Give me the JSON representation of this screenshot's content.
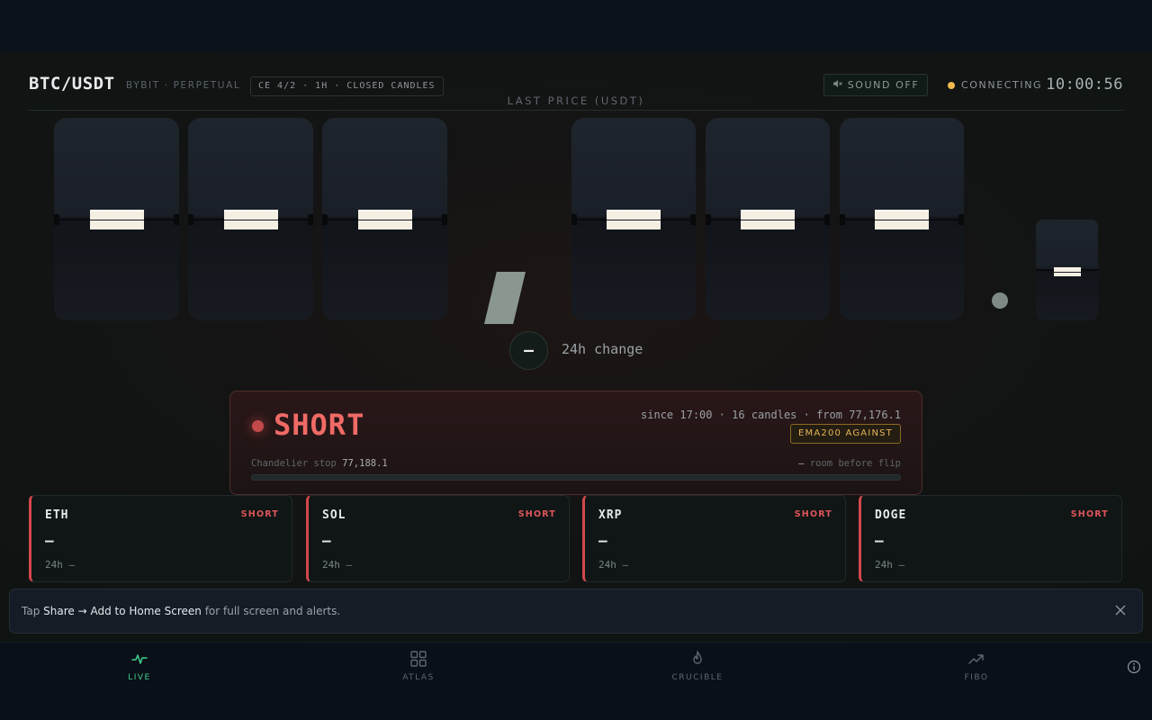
{
  "header": {
    "pair": "BTC/USDT",
    "exchange": "BYBIT · PERPETUAL",
    "mode_badge": "CE 4/2 · 1H · CLOSED CANDLES",
    "sound_label": "SOUND OFF",
    "connection_status": "CONNECTING",
    "connection_color": "#f2b84b",
    "clock": "10:00:56"
  },
  "price_board": {
    "label": "LAST PRICE (USDT)",
    "change_value": "—",
    "change_label": "24h change"
  },
  "signal": {
    "direction": "SHORT",
    "since": "since 17:00 · 16 candles · from 77,176.1",
    "badge": "EMA200 AGAINST",
    "stop_label": "Chandelier stop",
    "stop_value": "77,188.1",
    "room_value": "—",
    "room_label": "room before flip",
    "accent": "#f06a66"
  },
  "cards": [
    {
      "symbol": "ETH",
      "direction": "SHORT",
      "price": "—",
      "change": "24h —"
    },
    {
      "symbol": "SOL",
      "direction": "SHORT",
      "price": "—",
      "change": "24h —"
    },
    {
      "symbol": "XRP",
      "direction": "SHORT",
      "price": "—",
      "change": "24h —"
    },
    {
      "symbol": "DOGE",
      "direction": "SHORT",
      "price": "—",
      "change": "24h —"
    }
  ],
  "banner": {
    "pre": "Tap ",
    "share": "Share",
    "arrow": " → ",
    "add": "Add to Home Screen",
    "post": " for full screen and alerts.",
    "close_icon": "close-icon"
  },
  "nav": {
    "items": [
      {
        "label": "LIVE",
        "icon": "pulse-icon",
        "active": true
      },
      {
        "label": "ATLAS",
        "icon": "grid-icon",
        "active": false
      },
      {
        "label": "CRUCIBLE",
        "icon": "flame-icon",
        "active": false
      },
      {
        "label": "FIBO",
        "icon": "trend-up-icon",
        "active": false
      }
    ],
    "info_icon": "info-icon",
    "active_color": "#3ecf8e"
  }
}
